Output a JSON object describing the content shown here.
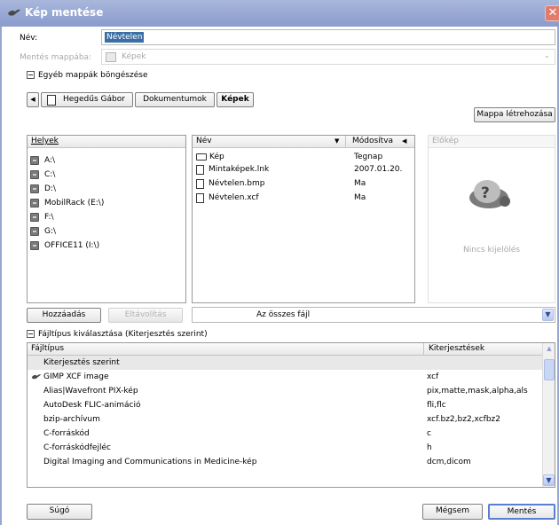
{
  "window": {
    "title": "Kép mentése",
    "close_glyph": "✕"
  },
  "name_field": {
    "label": "Név:",
    "value": "Névtelen"
  },
  "save_folder": {
    "label": "Mentés mappába:",
    "value": "Képek"
  },
  "browse_toggle": {
    "label": "Egyéb mappák böngészése"
  },
  "path_bar": {
    "back_glyph": "◀",
    "crumbs": [
      "Hegedűs Gábor",
      "Dokumentumok",
      "Képek"
    ],
    "create_folder_label": "Mappa létrehozása"
  },
  "places": {
    "header": "Helyek",
    "items": [
      "A:\\",
      "C:\\",
      "D:\\",
      "MobilRack (E:\\)",
      "F:\\",
      "G:\\",
      "OFFICE11 (I:\\)"
    ]
  },
  "files": {
    "col_name": "Név",
    "col_modified": "Módosítva",
    "sort_glyph": "▼",
    "modified_glyph": "◀",
    "rows": [
      {
        "name": "Kép",
        "modified": "Tegnap",
        "kind": "folder"
      },
      {
        "name": "Mintaképek.lnk",
        "modified": "2007.01.20.",
        "kind": "file"
      },
      {
        "name": "Névtelen.bmp",
        "modified": "Ma",
        "kind": "file"
      },
      {
        "name": "Névtelen.xcf",
        "modified": "Ma",
        "kind": "file"
      }
    ]
  },
  "preview": {
    "header": "Előkép",
    "empty_text": "Nincs kijelölés",
    "icon": "question-mark-icon"
  },
  "place_buttons": {
    "add": "Hozzáadás",
    "remove": "Eltávolítás"
  },
  "filter": {
    "value": "Az összes fájl"
  },
  "filetype": {
    "toggle_label": "Fájltípus kiválasztása (Kiterjesztés szerint)",
    "col_type": "Fájltípus",
    "col_ext": "Kiterjesztések",
    "rows": [
      {
        "type": "Kiterjesztés szerint",
        "ext": ""
      },
      {
        "type": "GIMP XCF image",
        "ext": "xcf"
      },
      {
        "type": "Alias|Wavefront PIX-kép",
        "ext": "pix,matte,mask,alpha,als"
      },
      {
        "type": "AutoDesk FLIC-animáció",
        "ext": "fli,flc"
      },
      {
        "type": "bzip-archívum",
        "ext": "xcf.bz2,bz2,xcfbz2"
      },
      {
        "type": "C-forráskód",
        "ext": "c"
      },
      {
        "type": "C-forráskódfejléc",
        "ext": "h"
      },
      {
        "type": "Digital Imaging and Communications in Medicine-kép",
        "ext": "dcm,dicom"
      }
    ]
  },
  "footer": {
    "help": "Súgó",
    "cancel": "Mégsem",
    "save": "Mentés"
  },
  "colors": {
    "accent": "#3a6ea5",
    "titlebar": "#95a6d3",
    "selected_row": "#e8e8e8"
  }
}
